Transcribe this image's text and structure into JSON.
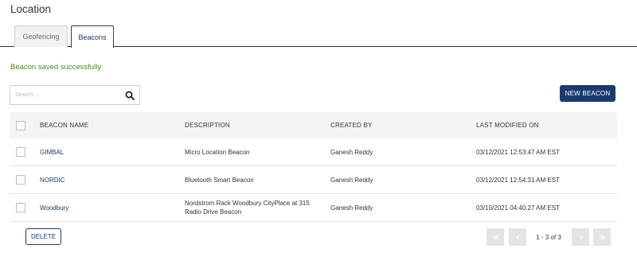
{
  "page": {
    "title": "Location"
  },
  "tabs": [
    {
      "label": "Geofencing",
      "active": false
    },
    {
      "label": "Beacons",
      "active": true
    }
  ],
  "status": {
    "message": "Beacon saved successfully"
  },
  "search": {
    "placeholder": "Search...",
    "value": ""
  },
  "toolbar": {
    "new_label": "NEW BEACON",
    "delete_label": "DELETE"
  },
  "table": {
    "columns": {
      "name": "BEACON NAME",
      "description": "DESCRIPTION",
      "created_by": "CREATED BY",
      "last_modified": "LAST MODIFIED ON"
    },
    "rows": [
      {
        "name": "GIMBAL",
        "description": "Micro Location Beacon",
        "created_by": "Ganesh Reddy",
        "last_modified": "03/12/2021 12:53:47 AM EST"
      },
      {
        "name": "NORDIC",
        "description": "Bluetooth Smart Beacon",
        "created_by": "Ganesh Reddy",
        "last_modified": "03/12/2021 12:54:31 AM EST"
      },
      {
        "name": "Woodbury",
        "description": "Nordstrom Rack Woodbury CityPlace at 315 Radio Drive Beacon",
        "created_by": "Ganesh Reddy",
        "last_modified": "03/10/2021 04:40:27 AM EST"
      }
    ]
  },
  "pagination": {
    "info": "1 - 3 of 3"
  },
  "colors": {
    "accent": "#1b3b6f",
    "success": "#4b8a1f",
    "header_bg": "#f4f4f5"
  }
}
